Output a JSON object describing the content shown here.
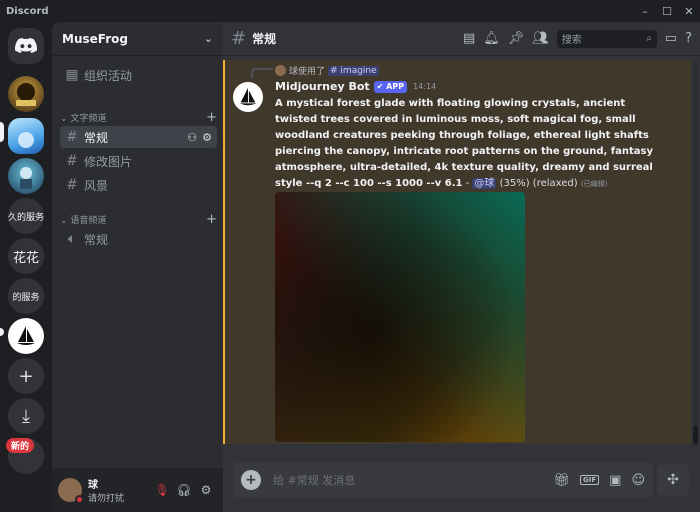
{
  "window": {
    "app_name": "Discord",
    "minimize": "–",
    "maximize": "☐",
    "close": "✕"
  },
  "servers": {
    "text_1": "久的服务",
    "text_2": "花花",
    "text_3": "的服务",
    "new_badge": "新的",
    "add": "+",
    "download": "⤓"
  },
  "guild": {
    "name": "MuseFrog",
    "chevron": "⌄"
  },
  "sidebar": {
    "events": "组织活动",
    "text_category": "文字频道",
    "voice_category": "语音频道",
    "add": "+",
    "text_channels": [
      "常规",
      "修改图片",
      "风景"
    ],
    "voice_channels": [
      "常规"
    ]
  },
  "user": {
    "name": "球",
    "status": "请勿打扰"
  },
  "header": {
    "channel": "常规",
    "search_placeholder": "搜索"
  },
  "message": {
    "reply_user": "球使用了",
    "reply_command": "imagine",
    "author": "Midjourney Bot",
    "badge": "✔ APP",
    "time": "14:14",
    "prompt": "A mystical forest glade with floating glowing crystals, ancient twisted trees covered in luminous moss, soft magical fog, small woodland creatures peeking through foliage, ethereal light shafts piercing the canopy, intricate root patterns on the ground, fantasy atmosphere, ultra-detailed, 4k texture quality, dreamy and surreal style --q 2 --c 100 --s 1000 --v 6.1",
    "separator": " - ",
    "mention": "@球",
    "progress_text": " (35%) (relaxed) ",
    "edited": "(已编辑)",
    "progress_percent": 35
  },
  "composer": {
    "placeholder": "给 #常规 发消息",
    "gif": "GIF"
  },
  "colors": {
    "accent": "#5865f2",
    "highlight_border": "#f0b232",
    "dnd": "#da373c"
  }
}
